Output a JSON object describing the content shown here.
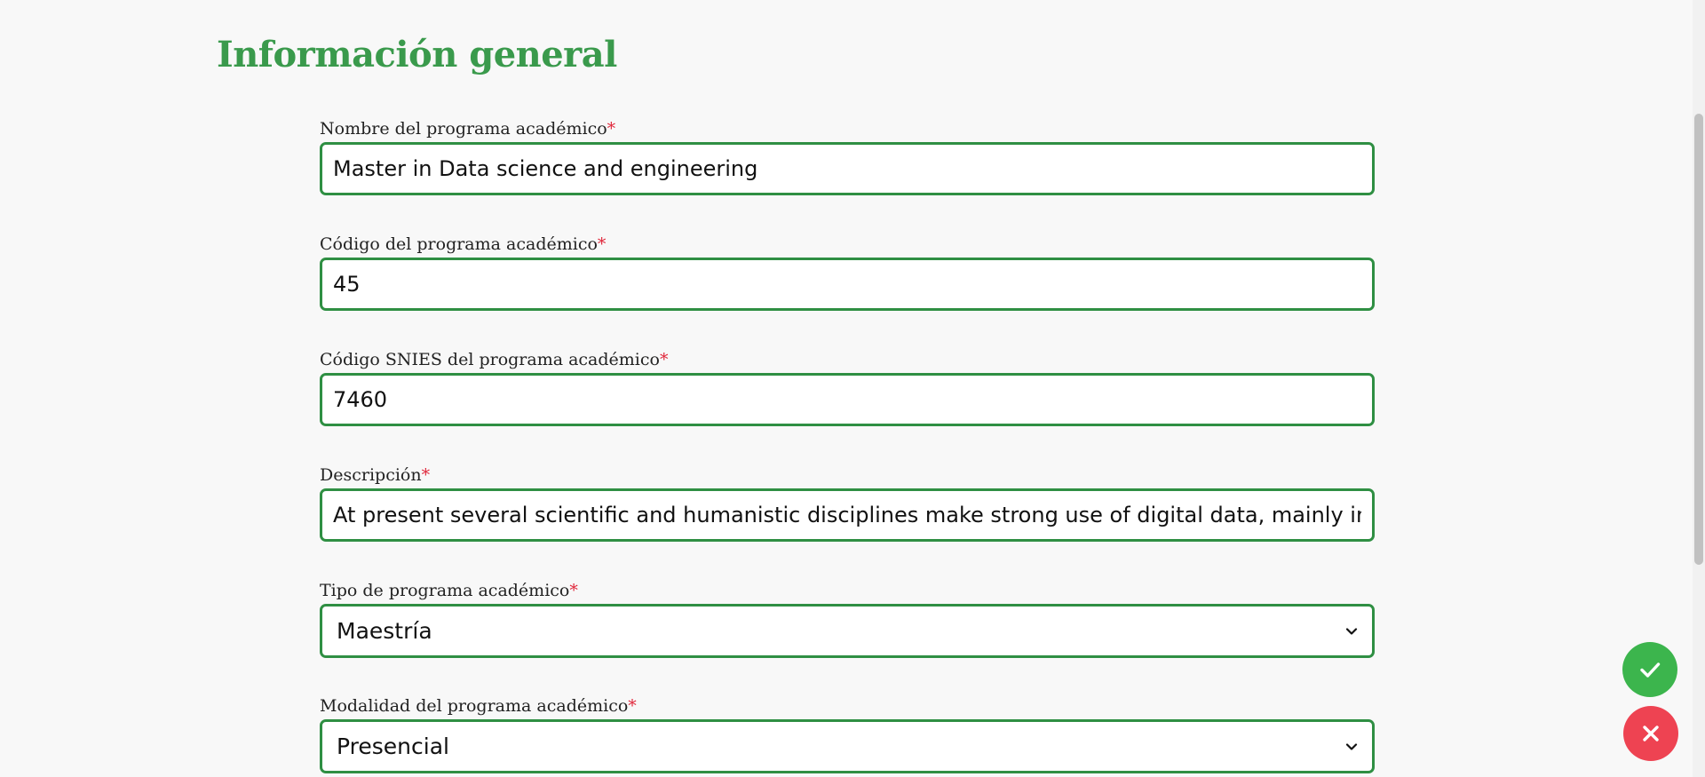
{
  "section": {
    "title": "Información general"
  },
  "form": {
    "required_marker": "*",
    "fields": [
      {
        "label": "Nombre del programa académico",
        "value": "Master in Data science and engineering"
      },
      {
        "label": "Código del programa académico",
        "value": "45"
      },
      {
        "label": "Código SNIES del programa académico",
        "value": "7460"
      },
      {
        "label": "Descripción",
        "value": "At present several scientific and humanistic disciplines make strong use of digital data, mainly in c"
      },
      {
        "label": "Tipo de programa académico",
        "selected": "Maestría"
      },
      {
        "label": "Modalidad del programa académico",
        "selected": "Presencial"
      }
    ]
  },
  "actions": {
    "confirm_icon": "check-icon",
    "cancel_icon": "close-icon"
  },
  "colors": {
    "accent_green": "#3a9a4c",
    "input_border": "#2f8f43",
    "required": "#e0263a",
    "confirm": "#3cb54d",
    "cancel": "#ee4352"
  }
}
